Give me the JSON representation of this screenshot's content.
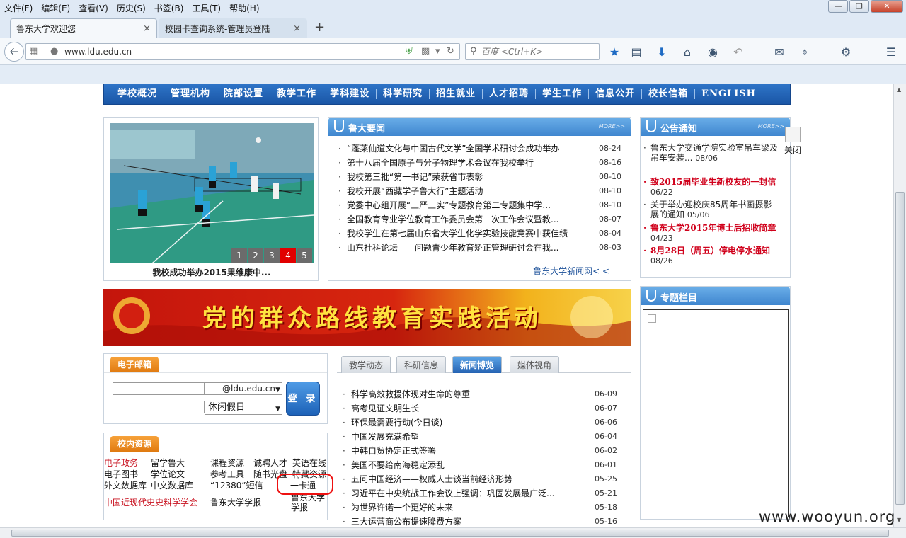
{
  "browser": {
    "menu": [
      "文件(F)",
      "编辑(E)",
      "查看(V)",
      "历史(S)",
      "书签(B)",
      "工具(T)",
      "帮助(H)"
    ],
    "tabs": [
      {
        "label": "鲁东大学欢迎您",
        "close": "×"
      },
      {
        "label": "校园卡查询系统-管理员登陆",
        "close": "×"
      }
    ],
    "new_tab": "+",
    "url": "www.ldu.edu.cn",
    "search_placeholder": "百度 <Ctrl+K>"
  },
  "nav": [
    "学校概况",
    "管理机构",
    "院部设置",
    "教学工作",
    "学科建设",
    "科学研究",
    "招生就业",
    "人才招聘",
    "学生工作",
    "信息公开",
    "校长信箱",
    "ENGLISH"
  ],
  "slideshow": {
    "pages": [
      "1",
      "2",
      "3",
      "4",
      "5"
    ],
    "active_page": "4",
    "caption": "我校成功举办2015果维康中..."
  },
  "news": {
    "title": "鲁大要闻",
    "more": "MORE>>",
    "items": [
      {
        "title": "“蓬莱仙道文化与中国古代文学”全国学术研讨会成功举办",
        "date": "08-24"
      },
      {
        "title": "第十八届全国原子与分子物理学术会议在我校举行",
        "date": "08-16"
      },
      {
        "title": "我校第三批“第一书记”荣获省市表彰",
        "date": "08-10"
      },
      {
        "title": "我校开展“西藏学子鲁大行”主题活动",
        "date": "08-10"
      },
      {
        "title": "党委中心组开展“三严三实”专题教育第二专题集中学...",
        "date": "08-10"
      },
      {
        "title": "全国教育专业学位教育工作委员会第一次工作会议暨教...",
        "date": "08-07"
      },
      {
        "title": "我校学生在第七届山东省大学生化学实验技能竞赛中获佳绩",
        "date": "08-04"
      },
      {
        "title": "山东社科论坛——问题青少年教育矫正管理研讨会在我...",
        "date": "08-03"
      }
    ],
    "link": "鲁东大学新闻网< <"
  },
  "notices": {
    "title": "公告通知",
    "more": "MORE>>",
    "items": [
      {
        "title": "鲁东大学交通学院实验室吊车梁及吊车安装...",
        "date": "08/06",
        "hot": false
      },
      {
        "title": "致2015届毕业生新校友的一封信",
        "date": "06/22",
        "hot": true
      },
      {
        "title": "关于举办迎校庆85周年书画摄影展的通知",
        "date": "05/06",
        "hot": false
      },
      {
        "title": "鲁东大学2015年博士后招收简章",
        "date": "04/23",
        "hot": true
      },
      {
        "title": "8月28日（周五）停电停水通知",
        "date": "08/26",
        "hot": true
      }
    ],
    "close_label": "关闭"
  },
  "banner": {
    "text": "党的群众路线教育实践活动"
  },
  "special": {
    "title": "专题栏目"
  },
  "mail": {
    "tag": "电子邮箱",
    "domain": "@ldu.edu.cn",
    "mode": "休闲假日",
    "login": "登 录"
  },
  "resources": {
    "tag": "校内资源",
    "links": [
      {
        "label": "电子政务",
        "red": true
      },
      {
        "label": "留学鲁大",
        "red": false
      },
      {
        "label": "课程资源",
        "red": false
      },
      {
        "label": "诚聘人才",
        "red": false
      },
      {
        "label": "英语在线",
        "red": false
      },
      {
        "label": "电子图书",
        "red": false
      },
      {
        "label": "学位论文",
        "red": false
      },
      {
        "label": "参考工具",
        "red": false
      },
      {
        "label": "随书光盘",
        "red": false
      },
      {
        "label": "特藏资源",
        "red": false
      },
      {
        "label": "外文数据库",
        "red": false
      },
      {
        "label": "中文数据库",
        "red": false
      },
      {
        "label": "“12380”短信",
        "red": false
      },
      {
        "label": "一卡通",
        "red": false
      },
      {
        "label": "中国近现代史史料学学会",
        "red": true
      },
      {
        "label": "鲁东大学学报",
        "red": false
      },
      {
        "label": "鲁东大学学报",
        "red": false
      }
    ]
  },
  "tabnews": {
    "tabs": [
      "教学动态",
      "科研信息",
      "新闻博览",
      "媒体视角"
    ],
    "active_tab": "新闻博览",
    "items": [
      {
        "title": "科学高效救援体现对生命的尊重",
        "date": "06-09"
      },
      {
        "title": "高考见证文明生长",
        "date": "06-07"
      },
      {
        "title": "环保最需要行动(今日谈)",
        "date": "06-06"
      },
      {
        "title": "中国发展充满希望",
        "date": "06-04"
      },
      {
        "title": "中韩自贸协定正式签署",
        "date": "06-02"
      },
      {
        "title": "美国不要给南海稳定添乱",
        "date": "06-01"
      },
      {
        "title": "五问中国经济——权威人士谈当前经济形势",
        "date": "05-25"
      },
      {
        "title": "习近平在中央统战工作会议上强调：巩固发展最广泛...",
        "date": "05-21"
      },
      {
        "title": "为世界许诺一个更好的未来",
        "date": "05-18"
      },
      {
        "title": "三大运营商公布提速降费方案",
        "date": "05-16"
      }
    ]
  },
  "watermark": "www.wooyun.org",
  "colors": {
    "nav_blue": "#1a56a6",
    "panel_blue": "#3f86cf",
    "hot_red": "#d0001b",
    "tag_orange": "#e07a10",
    "active_page": "#e10000"
  }
}
